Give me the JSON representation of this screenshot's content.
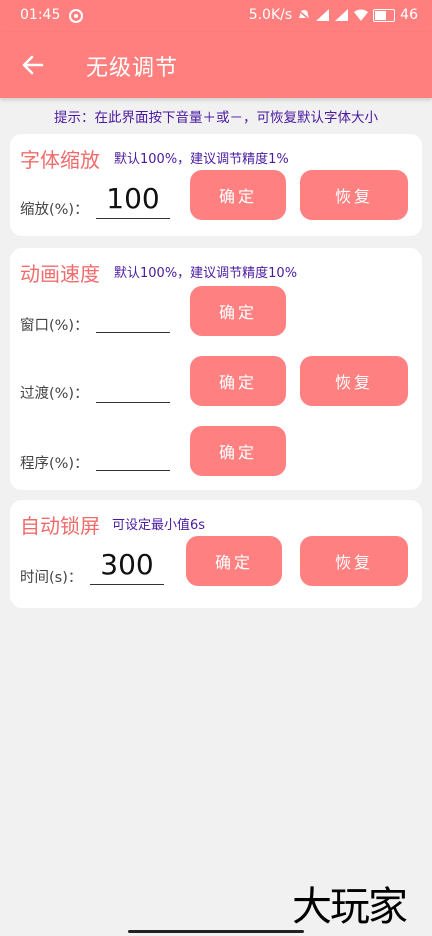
{
  "status_bar": {
    "time": "01:45",
    "net_speed": "5.0K/s",
    "battery_level": "46"
  },
  "app_bar": {
    "title": "无级调节"
  },
  "hint": "提示：在此界面按下音量＋或－，可恢复默认字体大小",
  "font_scale": {
    "title": "字体缩放",
    "note": "默认100%，建议调节精度1%",
    "label": "缩放(%)：",
    "value": "100",
    "confirm_label": "确定",
    "restore_label": "恢复"
  },
  "anim_speed": {
    "title": "动画速度",
    "note": "默认100%，建议调节精度10%",
    "rows": [
      {
        "label": "窗口(%)：",
        "value": "",
        "confirm_label": "确定"
      },
      {
        "label": "过渡(%)：",
        "value": "",
        "confirm_label": "确定",
        "restore_label": "恢复"
      },
      {
        "label": "程序(%)：",
        "value": "",
        "confirm_label": "确定"
      }
    ]
  },
  "auto_lock": {
    "title": "自动锁屏",
    "note": "可设定最小值6s",
    "label": "时间(s)：",
    "value": "300",
    "confirm_label": "确定",
    "restore_label": "恢复"
  },
  "watermark": "大玩家",
  "colors": {
    "accent": "#ff7f7f",
    "button": "#ff8080",
    "title": "#f26b6b",
    "note": "#4a1aa0"
  }
}
